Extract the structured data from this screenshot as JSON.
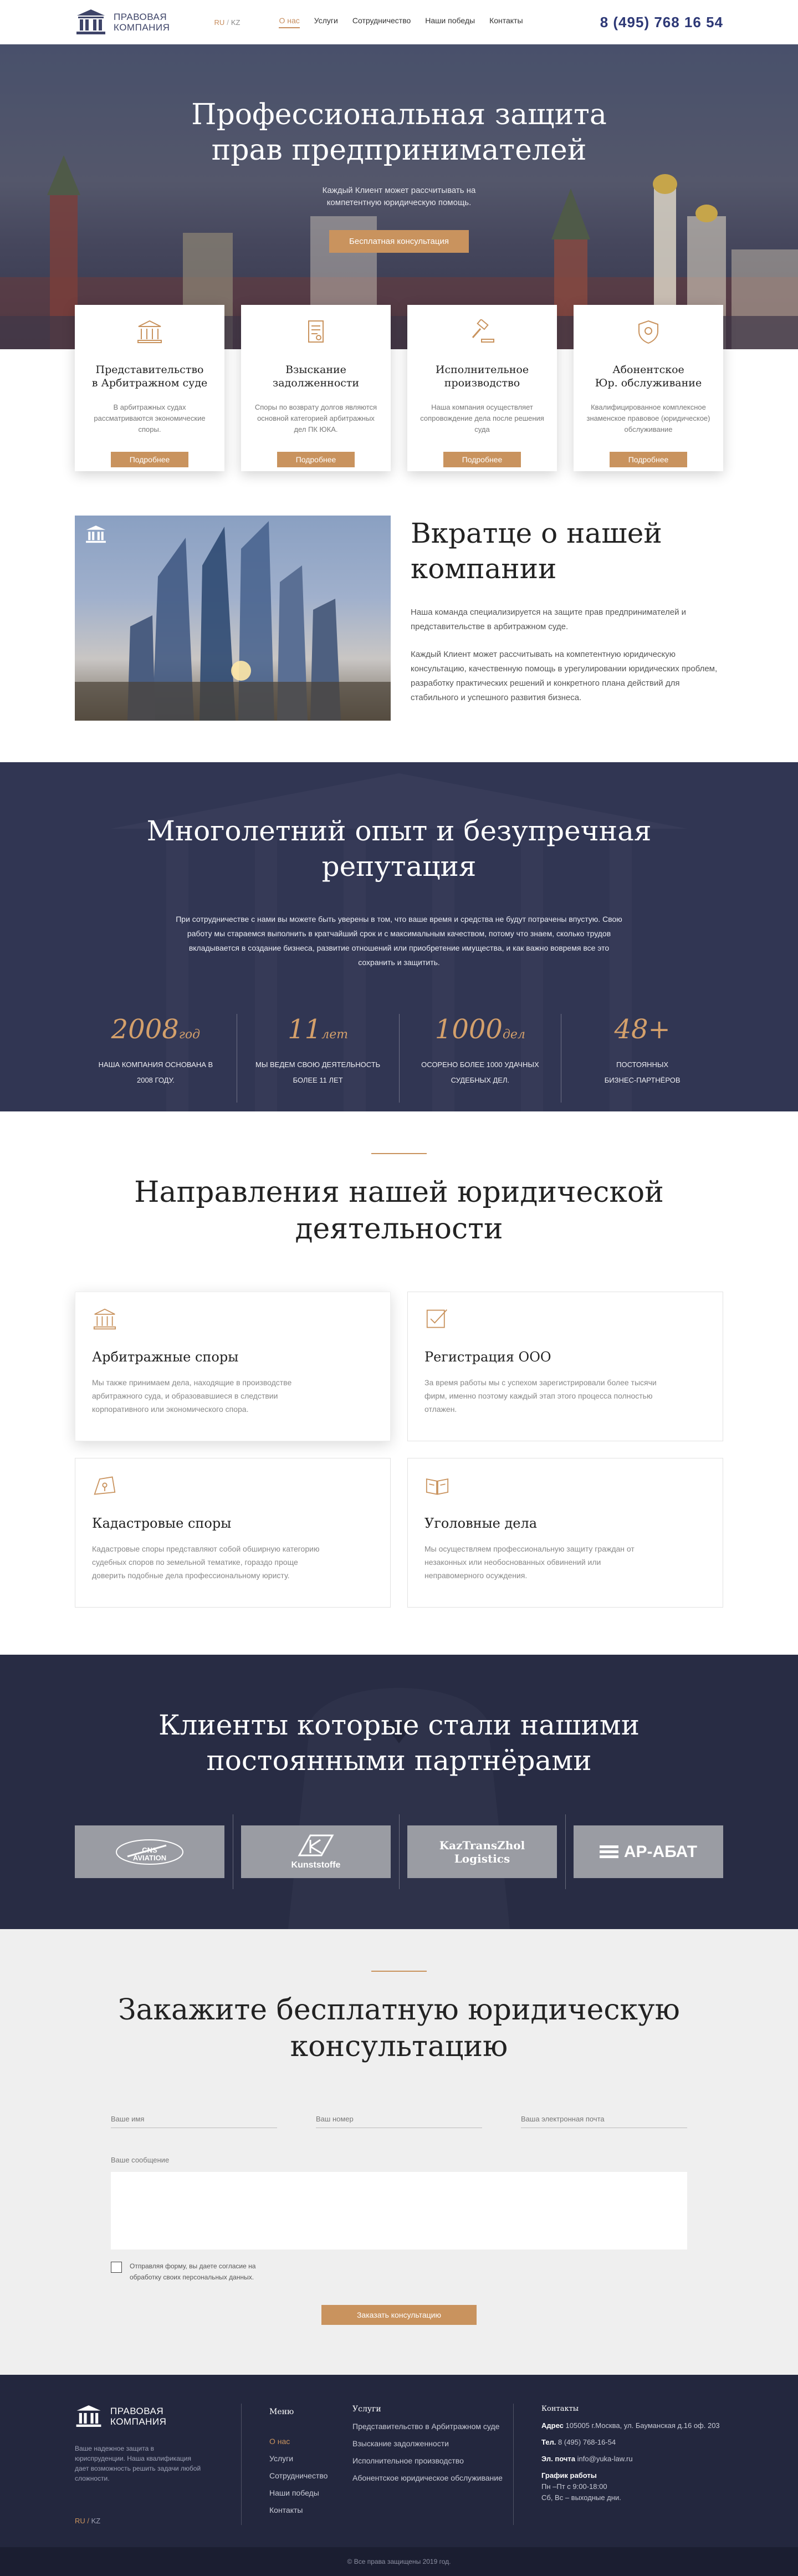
{
  "header": {
    "logo_line1": "Правовая",
    "logo_line2": "компания",
    "lang_ru": "RU",
    "lang_kz": "KZ",
    "nav": [
      "О нас",
      "Услуги",
      "Сотрудничество",
      "Наши победы",
      "Контакты"
    ],
    "phone": "8 (495) 768 16 54"
  },
  "hero": {
    "title_line1": "Профессиональная защита",
    "title_line2": "прав предпринимателей",
    "subtitle_line1": "Каждый Клиент может рассчитывать на",
    "subtitle_line2": "компетентную юридическую помощь.",
    "button": "Бесплатная консультация"
  },
  "services": [
    {
      "title_line1": "Представительство",
      "title_line2": "в Арбитражном суде",
      "text": "В арбитражных судах рассматриваются экономические споры.",
      "button": "Подробнее",
      "icon": "courthouse-icon"
    },
    {
      "title_line1": "Взыскание",
      "title_line2": "задолженности",
      "text": "Споры по возврату долгов являются основной категорией арбитражных дел ПК ЮКА.",
      "button": "Подробнее",
      "icon": "document-icon"
    },
    {
      "title_line1": "Исполнительное",
      "title_line2": "производство",
      "text": "Наша компания осуществляет сопровождение дела после решения суда",
      "button": "Подробнее",
      "icon": "gavel-icon"
    },
    {
      "title_line1": "Абонентское",
      "title_line2": "Юр. обслуживание",
      "text": "Квалифицированное комплексное знаменское правовое (юридическое) обслуживание",
      "button": "Подробнее",
      "icon": "shield-icon"
    }
  ],
  "about": {
    "title_line1": "Вкратце о нашей",
    "title_line2": "компании",
    "p1": "Наша команда   специализируется на защите прав предпринимателей и представительстве в арбитражном суде.",
    "p2": "Каждый Клиент может рассчитывать на компетентную юридическую консультацию, качественную помощь в урегулировании юридических проблем, разработку практических решений и конкретного плана действий для стабильного и успешного развития бизнеса."
  },
  "experience": {
    "title_line1": "Многолетний опыт и безупречная",
    "title_line2": "репутация",
    "lead": "При сотрудничестве с нами вы можете быть уверены в том, что ваше время и средства не будут потрачены впустую. Свою работу мы стараемся выполнить в кратчайший срок и с максимальным качеством, потому что знаем, сколько трудов вкладывается в создание бизнеса, развитие отношений или приобретение имущества, и как важно вовремя все это сохранить и защитить.",
    "stats": [
      {
        "num": "2008",
        "unit": "год",
        "cap1": "Наша компания основана в",
        "cap2": "2008 году."
      },
      {
        "num": "11",
        "unit": "лет",
        "cap1": "Мы ведем свою деятельность",
        "cap2": "более 11 лет"
      },
      {
        "num": "1000",
        "unit": "дел",
        "cap1": "Осорено более 1000 удачных",
        "cap2": "судебных дел."
      },
      {
        "num": "48+",
        "unit": "",
        "cap1": "постоянных",
        "cap2": "бизнес-партнёров"
      }
    ]
  },
  "directions": {
    "title_line1": "Направления нашей юридической",
    "title_line2": "деятельности",
    "items": [
      {
        "title": "Арбитражные споры",
        "text": "Мы также принимаем дела, находящие в производстве арбитражного суда, и образовавшиеся в следствии корпоративного или экономического спора."
      },
      {
        "title": "Регистрация ООО",
        "text": "За время работы мы с успехом зарегистрировали более тысячи фирм, именно поэтому каждый этап этого процесса полностью отлажен."
      },
      {
        "title": "Кадастровые споры",
        "text": "Кадастровые споры представляют собой обширную категорию судебных споров по земельной тематике, гораздо проще доверить подобные дела профессиональному юристу."
      },
      {
        "title": "Уголовные дела",
        "text": "Мы осуществляем профессиональную защиту граждан от незаконных или необоснованных обвинений или неправомерного осуждения."
      }
    ]
  },
  "partners": {
    "title_line1": "Клиенты которые стали нашими",
    "title_line2": "постоянными партнёрами",
    "logos": [
      {
        "line1": "CNS",
        "line2": "AVIATION"
      },
      {
        "line1": "Kunststoffe",
        "line2": ""
      },
      {
        "line1": "KazTransZhol",
        "line2": "Logistics"
      },
      {
        "line1": "АР-АБАТ",
        "line2": ""
      }
    ]
  },
  "consult": {
    "title_line1": "Закажите бесплатную юридическую",
    "title_line2": "консультацию",
    "name_placeholder": "Ваше имя",
    "phone_placeholder": "Ваш номер",
    "email_placeholder": "Ваша электронная почта",
    "message_label": "Ваше сообщение",
    "agree_line1": "Отправляя форму, вы даете согласие на",
    "agree_line2": "обработку своих персональных данных.",
    "button": "Заказать консультацию"
  },
  "footer": {
    "about": "Ваше надежное защита в юриспруденции. Наша квалификация дает возможность решить задачи любой сложности.",
    "lang_ru": "RU",
    "lang_kz": "KZ",
    "menu_title": "Меню",
    "menu": [
      "О нас",
      "Услуги",
      "Сотрудничество",
      "Наши победы",
      "Контакты"
    ],
    "services_title": "Услуги",
    "services": [
      "Представительство в Арбитражном суде",
      "Взыскание задолженности",
      "Исполнительное производство",
      "Абонентское юридическое обслуживание"
    ],
    "contacts_title": "Контакты",
    "address_label": "Адрес",
    "address": "105005 г.Москва, ул. Бауманская д.16 оф. 203",
    "phone_label": "Тел.",
    "phone": "8 (495) 768-16-54",
    "email_label": "Эл. почта",
    "email": "info@yuka-law.ru",
    "schedule_label": "График работы",
    "schedule1": "Пн –Пт с 9:00-18:00",
    "schedule2": "Сб, Вс – выходные дни.",
    "copyright": "© Все права защищены 2019 год."
  },
  "colors": {
    "accent": "#c9935e",
    "navy": "#2d3876",
    "dark": "#23273e"
  }
}
